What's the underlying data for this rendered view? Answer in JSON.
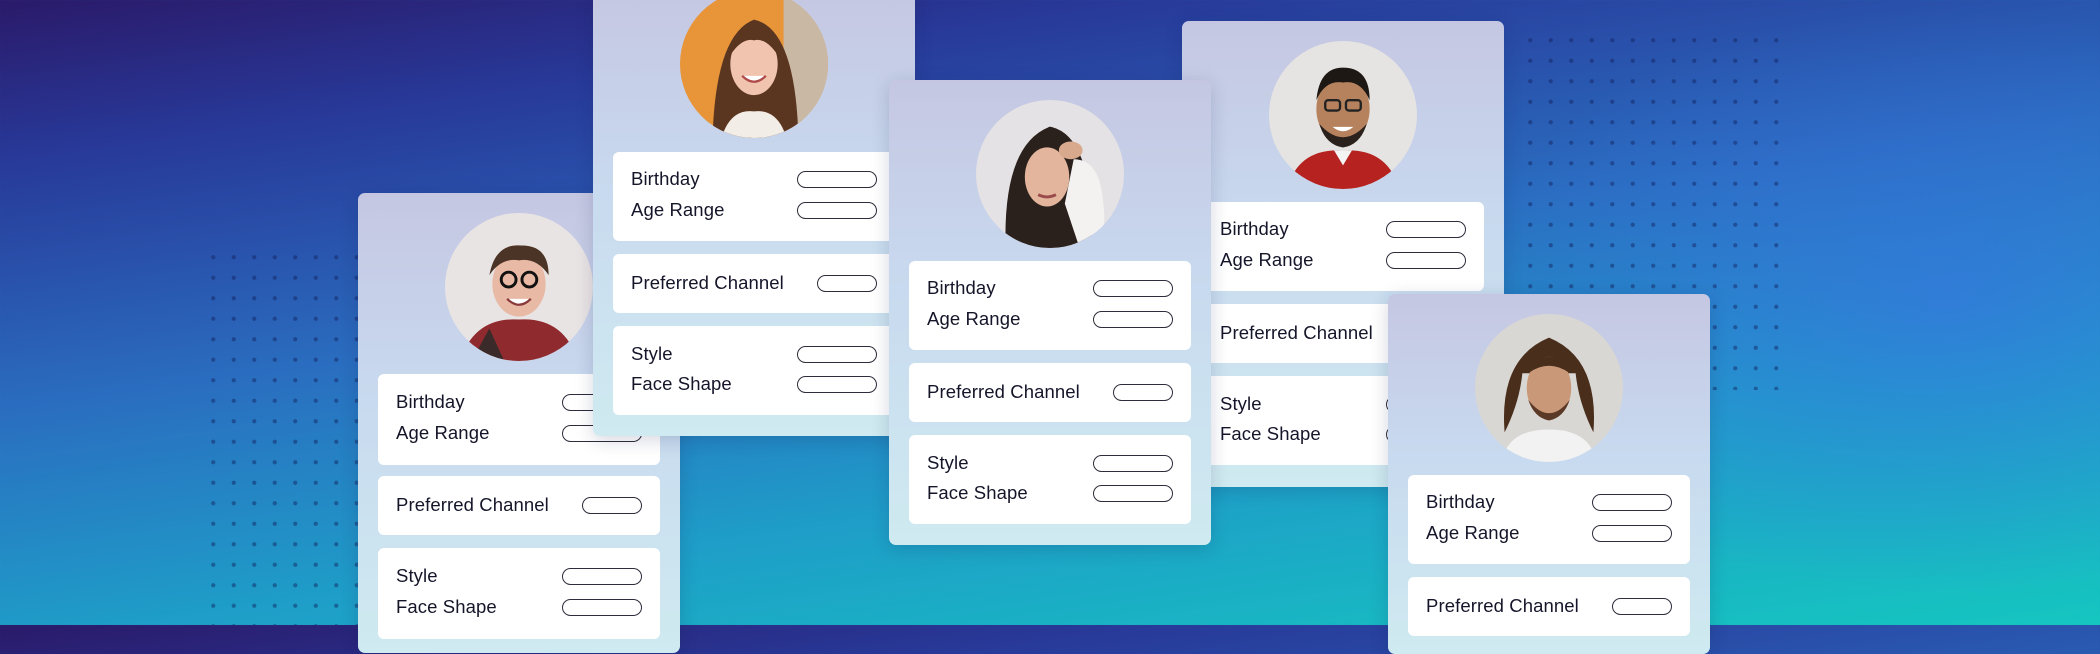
{
  "theme": {
    "card_bg": "#cfe0ef",
    "text": "#15152a",
    "pill_border": "#2c2c3a"
  },
  "profile_fields": {
    "birthday": "Birthday",
    "age_range": "Age Range",
    "preferred_channel": "Preferred Channel",
    "style": "Style",
    "face_shape": "Face Shape"
  },
  "profiles": [
    {
      "avatar": "woman-with-glasses-and-plaid-scarf-avatar"
    },
    {
      "avatar": "smiling-woman-long-brown-hair-avatar"
    },
    {
      "avatar": "woman-hand-in-hair-avatar"
    },
    {
      "avatar": "man-with-glasses-red-shirt-avatar"
    },
    {
      "avatar": "man-with-dreadlocks-avatar"
    }
  ]
}
